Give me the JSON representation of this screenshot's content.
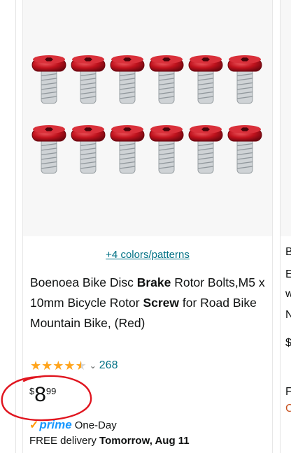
{
  "product": {
    "colors_link": "+4 colors/patterns",
    "title_parts": [
      {
        "text": "Boenoea Bike Disc ",
        "bold": false
      },
      {
        "text": "Brake",
        "bold": true
      },
      {
        "text": " Rotor Bolts,M5 x 10mm Bicycle Rotor ",
        "bold": false
      },
      {
        "text": "Screw",
        "bold": true
      },
      {
        "text": " for Road Bike Mountain Bike, (Red)",
        "bold": false
      }
    ],
    "rating_stars": 4.5,
    "rating_count": "268",
    "price_currency": "$",
    "price_whole": "8",
    "price_fraction": "99",
    "prime_label": "prime",
    "prime_speed": "One-Day",
    "delivery_prefix": "FREE delivery",
    "delivery_date": "Tomorrow, Aug 11"
  },
  "right_card_letters": [
    "B",
    "E",
    "w",
    "N",
    "$",
    "F",
    "C"
  ],
  "colors": {
    "link": "#007185",
    "star": "#ffa41c",
    "prime": "#1a98ff",
    "circle": "#e0151f",
    "bolt": "#c0121d"
  },
  "icons": [
    "star-icon",
    "chevron-down-icon",
    "prime-check-icon"
  ]
}
